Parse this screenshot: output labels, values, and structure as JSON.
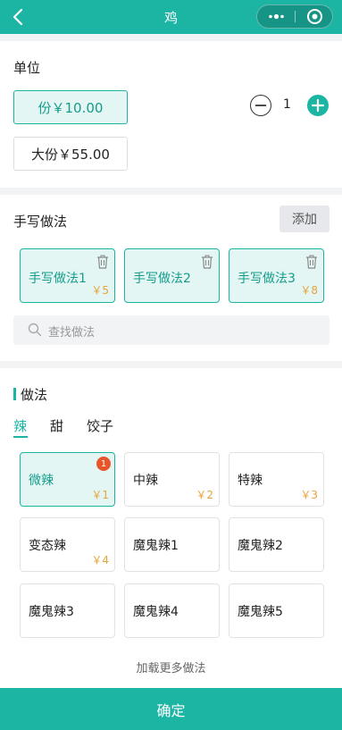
{
  "header": {
    "title": "鸡",
    "bg_color": "#1cb5a3"
  },
  "unit": {
    "title": "单位",
    "options": [
      {
        "label": "份￥10.00",
        "selected": true
      },
      {
        "label": "大份￥55.00",
        "selected": false
      }
    ],
    "quantity": "1"
  },
  "handwritten": {
    "title": "手写做法",
    "add_label": "添加",
    "items": [
      {
        "name": "手写做法1",
        "price": "￥5"
      },
      {
        "name": "手写做法2",
        "price": ""
      },
      {
        "name": "手写做法3",
        "price": "￥8"
      }
    ],
    "search_placeholder": "查找做法"
  },
  "methods": {
    "title": "做法",
    "tabs": [
      {
        "label": "辣",
        "active": true
      },
      {
        "label": "甜",
        "active": false
      },
      {
        "label": "饺子",
        "active": false
      }
    ],
    "items": [
      {
        "name": "微辣",
        "price": "￥1",
        "selected": true,
        "badge": "1"
      },
      {
        "name": "中辣",
        "price": "￥2",
        "selected": false
      },
      {
        "name": "特辣",
        "price": "￥3",
        "selected": false
      },
      {
        "name": "变态辣",
        "price": "￥4",
        "selected": false
      },
      {
        "name": "魔鬼辣1",
        "price": "",
        "selected": false
      },
      {
        "name": "魔鬼辣2",
        "price": "",
        "selected": false
      },
      {
        "name": "魔鬼辣3",
        "price": "",
        "selected": false
      },
      {
        "name": "魔鬼辣4",
        "price": "",
        "selected": false
      },
      {
        "name": "魔鬼辣5",
        "price": "",
        "selected": false
      }
    ],
    "load_more": "加载更多做法"
  },
  "confirm_label": "确定",
  "colors": {
    "accent": "#1cb5a3",
    "price": "#e8a33b",
    "badge": "#e8552a"
  }
}
